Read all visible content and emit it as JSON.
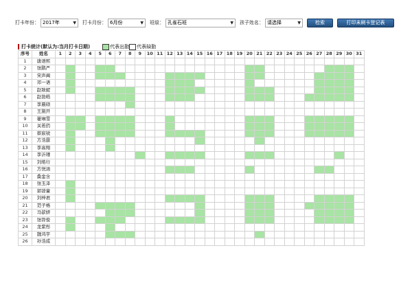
{
  "filters": {
    "year_label": "打卡年份：",
    "year_value": "2017年",
    "month_label": "打卡月份：",
    "month_value": "6月份",
    "class_label": "班级：",
    "class_value": "孔雀石班",
    "child_label": "孩子姓名：",
    "child_value": "请选择",
    "search_label": "检索",
    "print_label": "打印未刷卡登记表"
  },
  "section": {
    "title": "打卡统计(默认为:当月打卡日期)",
    "legend_present": "代表出勤",
    "legend_absent": "代表缺勤"
  },
  "colors": {
    "present": "#a8e4a3",
    "absent": "#ffffff",
    "button": "#2c5f96",
    "title_bar": "#b80000"
  },
  "table": {
    "seq_header": "序号",
    "name_header": "姓名",
    "days": [
      "1",
      "2",
      "3",
      "4",
      "5",
      "6",
      "7",
      "8",
      "9",
      "10",
      "11",
      "12",
      "13",
      "14",
      "15",
      "16",
      "17",
      "18",
      "19",
      "20",
      "21",
      "22",
      "23",
      "24",
      "25",
      "26",
      "27",
      "28",
      "29",
      "30",
      "31"
    ],
    "rows": [
      {
        "seq": "1",
        "name": "唐语熙",
        "attendance": "0000000000000000000000000000000"
      },
      {
        "seq": "2",
        "name": "张鹏严",
        "attendance": "0100110000000000000110000001110"
      },
      {
        "seq": "3",
        "name": "宋声阖",
        "attendance": "0100111000011110000110000011110"
      },
      {
        "seq": "4",
        "name": "邓一语",
        "attendance": "0100000000011100000100000011110"
      },
      {
        "seq": "5",
        "name": "赵致妮",
        "attendance": "0100111100011110000111000011110"
      },
      {
        "seq": "6",
        "name": "赵勃皓",
        "attendance": "0000111100011100000111000111110"
      },
      {
        "seq": "7",
        "name": "李晨硕",
        "attendance": "0000000100000000000000000000000"
      },
      {
        "seq": "8",
        "name": "王施开",
        "attendance": "0000000000000000000000000000000"
      },
      {
        "seq": "9",
        "name": "瞿琳雪",
        "attendance": "0110111100010000000111000111110"
      },
      {
        "seq": "10",
        "name": "关若药",
        "attendance": "0110111100010000000111000111110"
      },
      {
        "seq": "11",
        "name": "蔡宸锐",
        "attendance": "0100111100011110000111000111110"
      },
      {
        "seq": "12",
        "name": "方浩霆",
        "attendance": "0100010000000010000010000000000"
      },
      {
        "seq": "13",
        "name": "李高翔",
        "attendance": "0100010000000000000000000000000"
      },
      {
        "seq": "14",
        "name": "李沂瑾",
        "attendance": "0000000010011110000111000000100"
      },
      {
        "seq": "15",
        "name": "刘皓行",
        "attendance": "0000000000000000000000000000000"
      },
      {
        "seq": "16",
        "name": "方悦涵",
        "attendance": "0000000000011100000100000011000"
      },
      {
        "seq": "17",
        "name": "桑金含",
        "attendance": "0000000000000000000000000000000"
      },
      {
        "seq": "18",
        "name": "张玉泽",
        "attendance": "0100000000000000000000000000000"
      },
      {
        "seq": "19",
        "name": "郭骍童",
        "attendance": "0100000000000000000000000000000"
      },
      {
        "seq": "20",
        "name": "刘梓君",
        "attendance": "0100000000011110000111000011110"
      },
      {
        "seq": "21",
        "name": "范子格",
        "attendance": "0000111100000010000111000111110"
      },
      {
        "seq": "22",
        "name": "马歆妍",
        "attendance": "0000011100000010000111000011110"
      },
      {
        "seq": "23",
        "name": "张铧俊",
        "attendance": "0100111000011110000111000011110"
      },
      {
        "seq": "24",
        "name": "龙紫彤",
        "attendance": "0100010000000000000000000000000"
      },
      {
        "seq": "25",
        "name": "魏鸿宇",
        "attendance": "0000011100000000000010000000000"
      },
      {
        "seq": "26",
        "name": "孙浩成",
        "attendance": "0000000000000000000000000000000"
      }
    ]
  }
}
